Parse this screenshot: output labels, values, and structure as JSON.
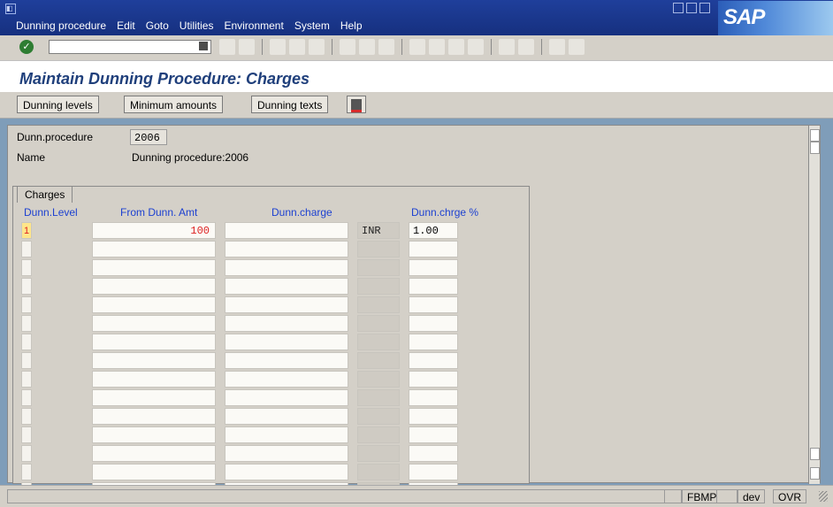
{
  "window": {
    "menu": [
      "Dunning procedure",
      "Edit",
      "Goto",
      "Utilities",
      "Environment",
      "System",
      "Help"
    ],
    "logo": "SAP",
    "icons": [
      "menu-icon",
      "minimize-icon",
      "restore-icon",
      "close-icon"
    ]
  },
  "toolbar": {
    "command_value": "",
    "icons": [
      "check-icon",
      "back-icon",
      "save-icon",
      "green-back-icon",
      "exit-icon",
      "cancel-icon",
      "print-icon",
      "find-icon",
      "find-next-icon",
      "first-page-icon",
      "prev-page-icon",
      "next-page-icon",
      "last-page-icon",
      "layout-icon",
      "settings-icon",
      "help-icon",
      "monitor-icon"
    ]
  },
  "screen": {
    "title": "Maintain Dunning Procedure: Charges",
    "buttons": [
      "Dunning levels",
      "Minimum amounts",
      "Dunning texts"
    ],
    "save_icon": "save-icon"
  },
  "header": {
    "proc_label": "Dunn.procedure",
    "proc_value": "2006",
    "name_label": "Name",
    "name_value": "Dunning procedure:2006"
  },
  "charges": {
    "tab": "Charges",
    "columns": [
      "Dunn.Level",
      "From Dunn. Amt",
      "Dunn.charge",
      "Dunn.chrge %"
    ],
    "rows": [
      {
        "level": "1",
        "from": "100",
        "charge": "",
        "cur": "INR",
        "pct": "1.00"
      },
      {
        "level": "",
        "from": "",
        "charge": "",
        "cur": "",
        "pct": ""
      },
      {
        "level": "",
        "from": "",
        "charge": "",
        "cur": "",
        "pct": ""
      },
      {
        "level": "",
        "from": "",
        "charge": "",
        "cur": "",
        "pct": ""
      },
      {
        "level": "",
        "from": "",
        "charge": "",
        "cur": "",
        "pct": ""
      },
      {
        "level": "",
        "from": "",
        "charge": "",
        "cur": "",
        "pct": ""
      },
      {
        "level": "",
        "from": "",
        "charge": "",
        "cur": "",
        "pct": ""
      },
      {
        "level": "",
        "from": "",
        "charge": "",
        "cur": "",
        "pct": ""
      },
      {
        "level": "",
        "from": "",
        "charge": "",
        "cur": "",
        "pct": ""
      },
      {
        "level": "",
        "from": "",
        "charge": "",
        "cur": "",
        "pct": ""
      },
      {
        "level": "",
        "from": "",
        "charge": "",
        "cur": "",
        "pct": ""
      },
      {
        "level": "",
        "from": "",
        "charge": "",
        "cur": "",
        "pct": ""
      },
      {
        "level": "",
        "from": "",
        "charge": "",
        "cur": "",
        "pct": ""
      },
      {
        "level": "",
        "from": "",
        "charge": "",
        "cur": "",
        "pct": ""
      },
      {
        "level": "",
        "from": "",
        "charge": "",
        "cur": "",
        "pct": ""
      }
    ]
  },
  "status": {
    "items": [
      "FBMP",
      "dev",
      "OVR"
    ],
    "icons": [
      "triangle-right-icon",
      "session-icon"
    ]
  }
}
